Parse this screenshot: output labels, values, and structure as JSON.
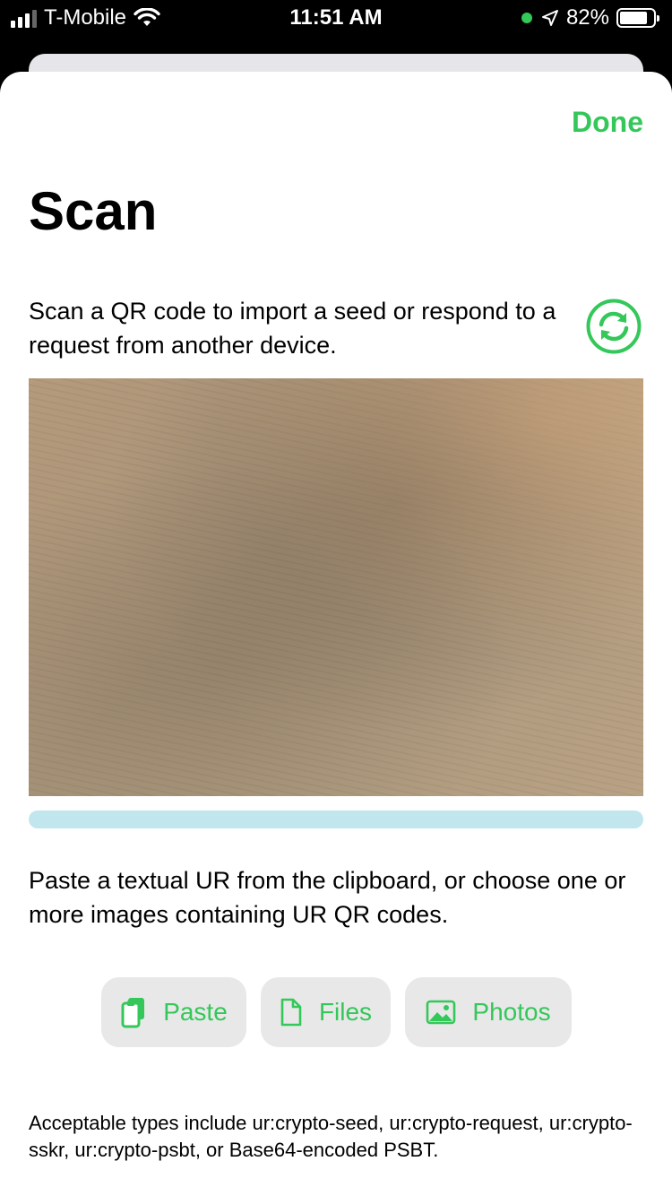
{
  "status_bar": {
    "carrier": "T-Mobile",
    "time": "11:51 AM",
    "battery": "82%",
    "battery_level": 0.82
  },
  "header": {
    "done_label": "Done",
    "title": "Scan"
  },
  "intro": "Scan a QR code to import a seed or respond to a request from another device.",
  "scan_progress": 1.0,
  "paste_instructions": "Paste a textual UR from the clipboard, or choose one or more images containing UR QR codes.",
  "buttons": [
    {
      "label": "Paste",
      "icon": "clipboard-icon"
    },
    {
      "label": "Files",
      "icon": "document-icon"
    },
    {
      "label": "Photos",
      "icon": "photo-icon"
    }
  ],
  "footer": "Acceptable types include ur:crypto-seed, ur:crypto-request, ur:crypto-sskr, ur:crypto-psbt, or Base64-encoded PSBT.",
  "colors": {
    "accent": "#34c759",
    "progress": "#c2e6ee",
    "button_bg": "#e8e8e8"
  }
}
